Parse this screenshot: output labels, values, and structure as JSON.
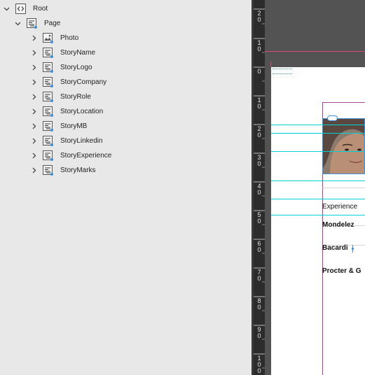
{
  "structure": {
    "root": {
      "label": "Root"
    },
    "page": {
      "label": "Page"
    },
    "children": [
      {
        "label": "Photo",
        "icon": "image-element-icon"
      },
      {
        "label": "StoryName",
        "icon": "story-element-icon"
      },
      {
        "label": "StoryLogo",
        "icon": "story-element-icon"
      },
      {
        "label": "StoryCompany",
        "icon": "story-element-icon"
      },
      {
        "label": "StoryRole",
        "icon": "story-element-icon"
      },
      {
        "label": "StoryLocation",
        "icon": "story-element-icon"
      },
      {
        "label": "StoryMB",
        "icon": "story-element-icon"
      },
      {
        "label": "StoryLinkedin",
        "icon": "story-element-icon"
      },
      {
        "label": "StoryExperience",
        "icon": "story-element-icon"
      },
      {
        "label": "StoryMarks",
        "icon": "story-element-icon"
      }
    ]
  },
  "ruler": {
    "labels": [
      "20",
      "10",
      "0",
      "10",
      "20",
      "30",
      "40",
      "50",
      "60",
      "70",
      "80",
      "90",
      "100"
    ]
  },
  "canvas": {
    "lines": [
      "Experience",
      "Mondelez",
      "Bacardi",
      "Procter & G"
    ]
  },
  "colors": {
    "guide": "#00d1d8",
    "margin": "#b0409a",
    "accent": "#3f8ed8",
    "pasteboard": "#535353"
  }
}
